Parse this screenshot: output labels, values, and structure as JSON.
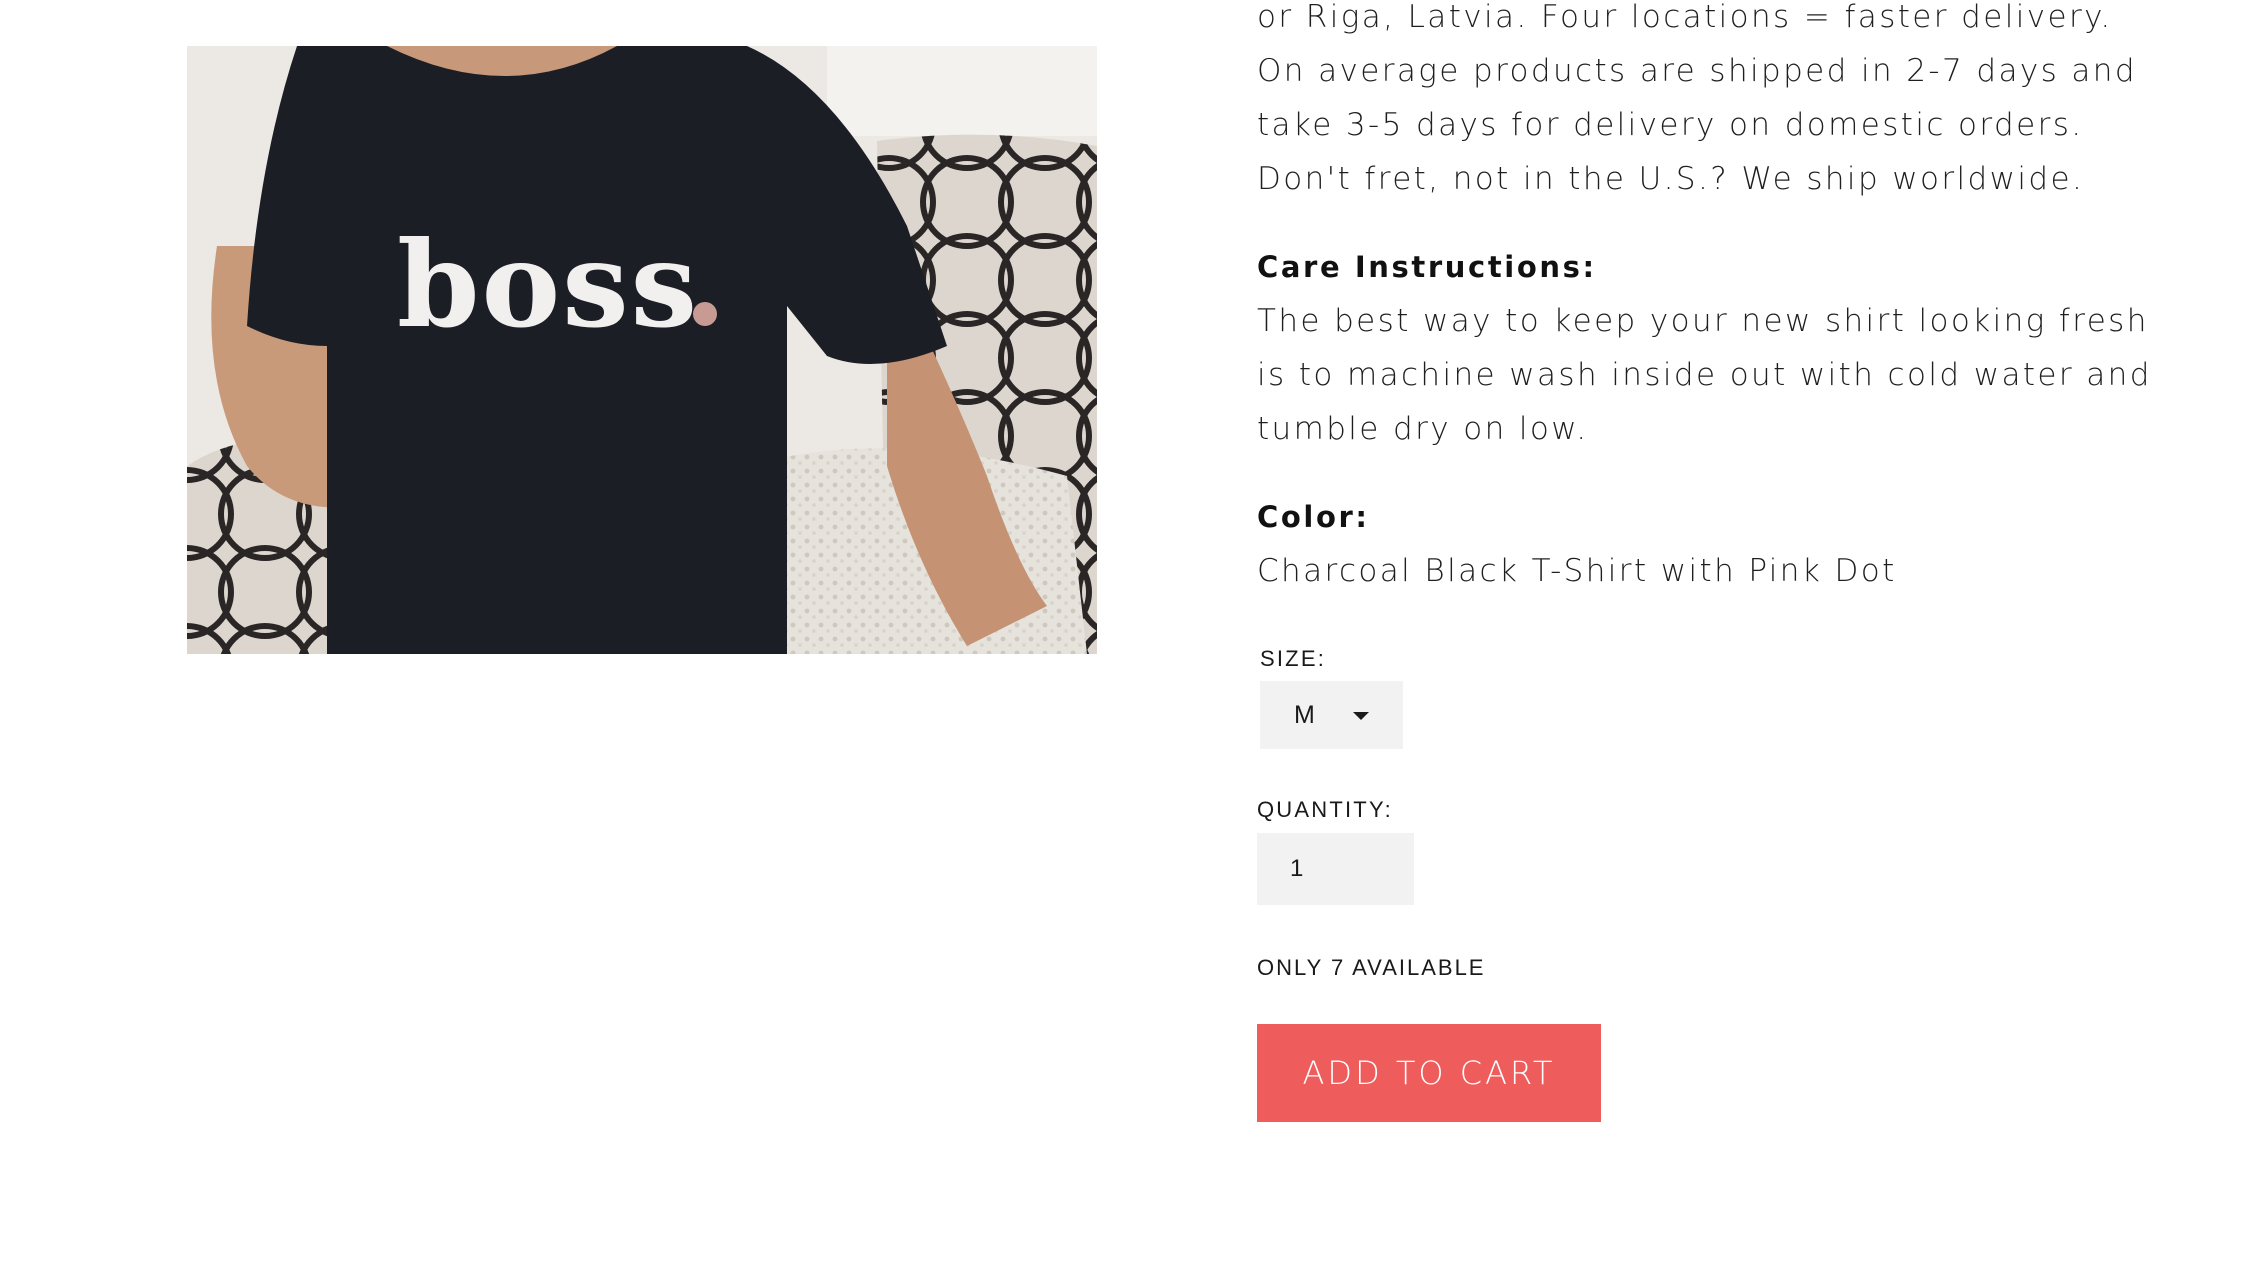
{
  "product_image": {
    "alt": "Model wearing charcoal t-shirt printed boss.",
    "print_text": "boss"
  },
  "description": {
    "lead_lines": [
      "or Riga, Latvia. Four locations = faster delivery.",
      "On average products are shipped in 2-7 days and",
      "take 3-5 days for delivery on domestic orders.",
      "Don't fret, not in the U.S.? We ship worldwide."
    ],
    "care_heading": "Care Instructions:",
    "care_lines": [
      "The best way to keep your new shirt looking fresh",
      "is to machine wash inside out with cold water and",
      "tumble dry on low."
    ],
    "color_heading": "Color:",
    "color_value": "Charcoal Black T-Shirt with Pink Dot"
  },
  "form": {
    "size_label": "SIZE:",
    "size_selected": "M",
    "size_icon": "chevron-down-icon",
    "quantity_label": "QUANTITY:",
    "quantity_value": "1",
    "stock_text": "ONLY 7 AVAILABLE"
  },
  "cart": {
    "button_label": "ADD TO CART",
    "button_color": "#ee5c5c"
  },
  "colors": {
    "shirt": "#1c1e26",
    "print": "#f2f0ef",
    "dot_accent": "#c79b94"
  }
}
